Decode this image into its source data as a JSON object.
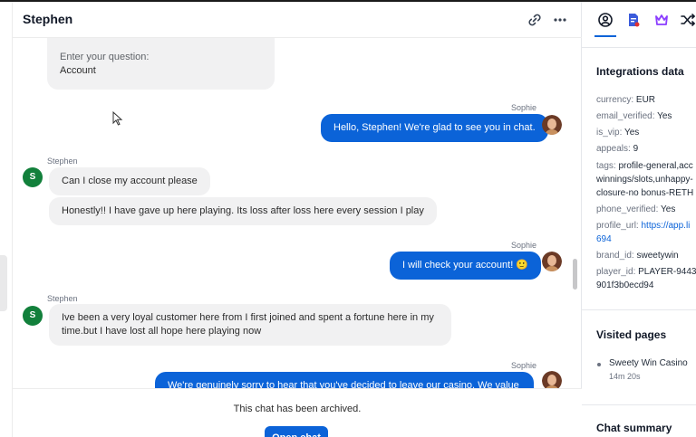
{
  "chat": {
    "title": "Stephen",
    "form": {
      "label": "Enter your question:",
      "value": "Account"
    },
    "messages": [
      {
        "sender": "Sophie",
        "text": "Hello, Stephen! We're glad to see you in chat."
      },
      {
        "sender": "Stephen",
        "avatar_initial": "S",
        "texts": [
          "Can I close my account please",
          "Honestly!! I have gave up here playing. Its loss after loss here every session I play"
        ]
      },
      {
        "sender": "Sophie",
        "text": "I will check your account! 🙂"
      },
      {
        "sender": "Stephen",
        "avatar_initial": "S",
        "texts": [
          "Ive been a very loyal customer here from I first joined and spent a fortune here in my",
          "time.but I have lost all hope here playing now"
        ]
      },
      {
        "sender": "Sophie",
        "text": "We're genuinely sorry to hear that you've decided to leave our casino. We value"
      }
    ],
    "archived_text": "This chat has been archived.",
    "open_chat_label": "Open chat"
  },
  "side": {
    "integrations_title": "Integrations data",
    "fields": [
      {
        "key": "currency:",
        "value": "EUR"
      },
      {
        "key": "email_verified:",
        "value": "Yes"
      },
      {
        "key": "is_vip:",
        "value": "Yes"
      },
      {
        "key": "appeals:",
        "value": "9"
      },
      {
        "key": "tags:",
        "value": "profile-general,acc"
      },
      {
        "key": "",
        "value": "winnings/slots,unhappy-"
      },
      {
        "key": "",
        "value": "closure-no bonus-RETH"
      },
      {
        "key": "phone_verified:",
        "value": "Yes"
      },
      {
        "key": "profile_url:",
        "value": "https://app.li"
      },
      {
        "key": "",
        "value": "694"
      },
      {
        "key": "brand_id:",
        "value": "sweetywin"
      },
      {
        "key": "player_id:",
        "value": "PLAYER-9443"
      },
      {
        "key": "",
        "value": "901f3b0ecd94"
      }
    ],
    "visited_title": "Visited pages",
    "visited": {
      "name": "Sweety Win Casino",
      "time": "14m 20s"
    },
    "summary_title": "Chat summary"
  },
  "colors": {
    "accent": "#0b63d8",
    "stephen_avatar": "#12803b",
    "bubble_in": "#f1f1f2"
  },
  "icons": [
    "link-icon",
    "more-icon",
    "user-circle-icon",
    "doc-icon",
    "crown-icon",
    "shuffle-icon"
  ]
}
